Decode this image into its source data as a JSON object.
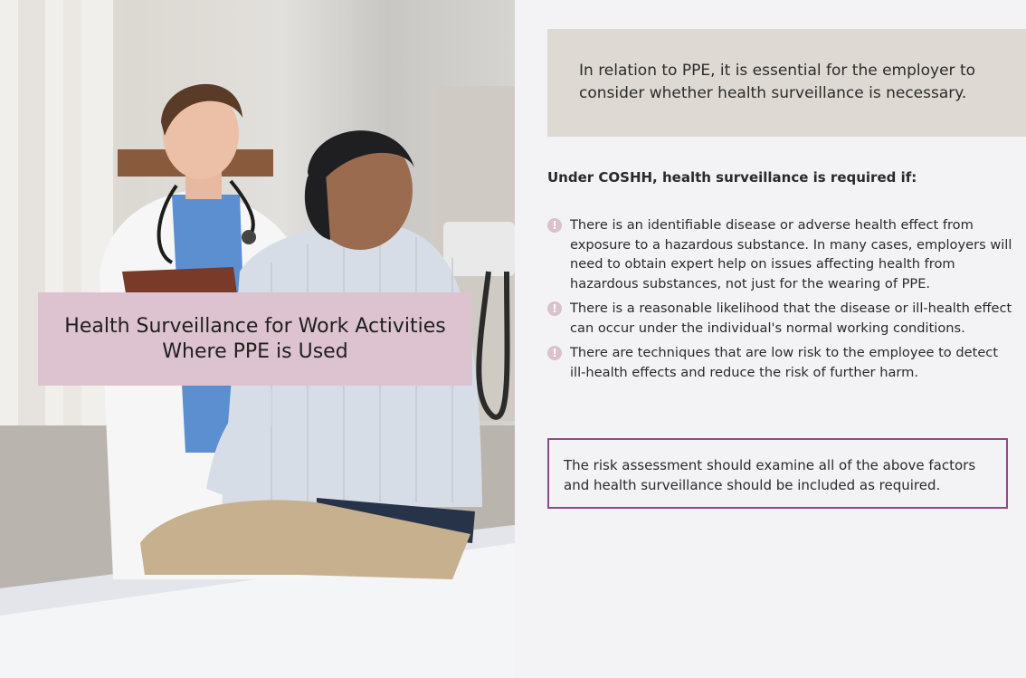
{
  "hero": {
    "image_alt": "Doctor with clipboard consulting a patient seated on an examination bed",
    "title": "Health Surveillance for Work Activities Where PPE is Used"
  },
  "intro": {
    "text": "In relation to PPE, it is essential for the employer to consider whether health surveillance is necessary."
  },
  "coshh": {
    "heading": "Under COSHH, health surveillance is required if:",
    "bullet_icon": "exclamation-icon",
    "items": [
      "There is an identifiable disease or adverse health effect from exposure to a hazardous substance. In many cases, employers will need to obtain expert help on issues affecting health from hazardous substances, not just for the wearing of PPE.",
      "There is a reasonable likelihood that the disease or ill-health effect can occur under the individual's normal working conditions.",
      "There are techniques that are low risk to the employee to detect ill-health effects and reduce the risk of further harm."
    ]
  },
  "note": {
    "text": "The risk assessment should examine all of the above factors and health surveillance should be included as required."
  },
  "colors": {
    "page_bg": "#f3f3f5",
    "title_card": "#dcc3cf",
    "intro_box": "#dedad3",
    "bullet": "#dac1cd",
    "note_border": "#8a4b89"
  }
}
